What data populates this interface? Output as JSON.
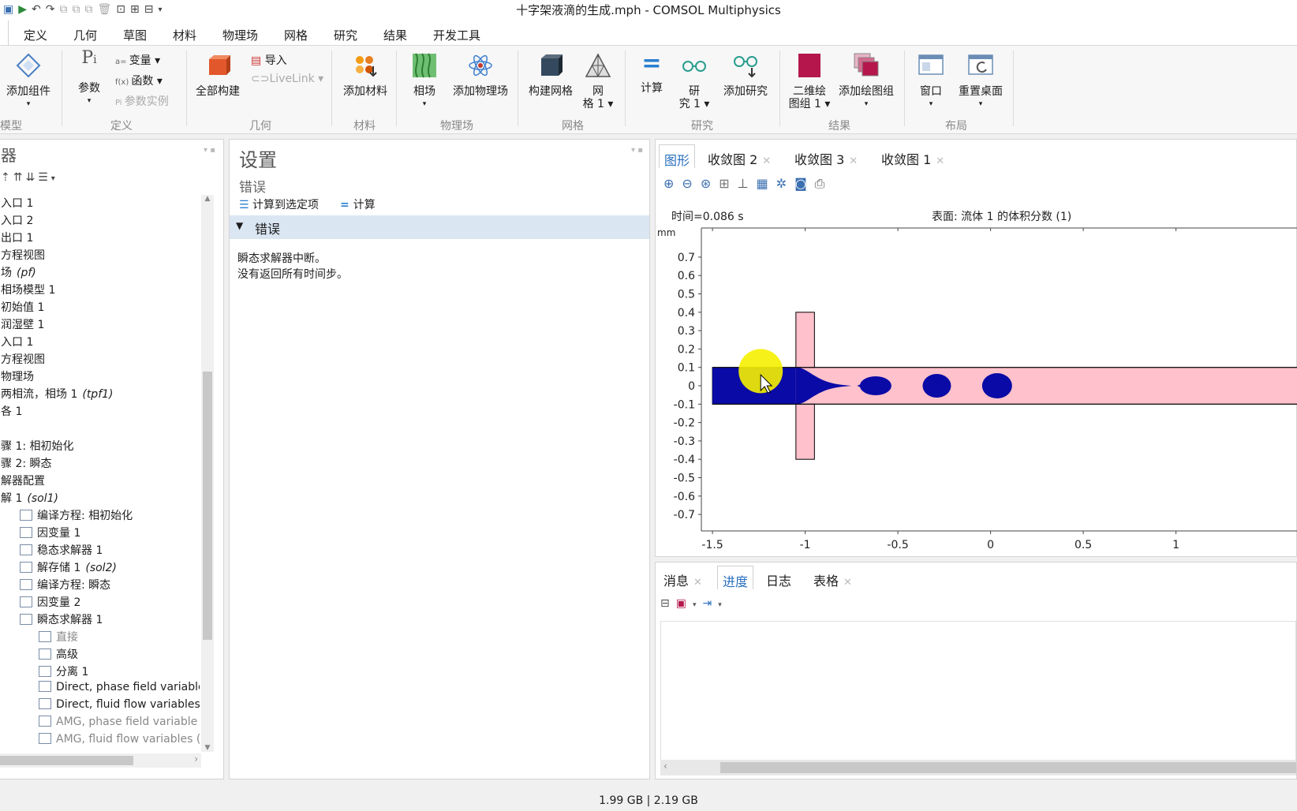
{
  "window": {
    "title": "十字架液滴的生成.mph - COMSOL Multiphysics"
  },
  "menu": {
    "tabs": [
      "定义",
      "几何",
      "草图",
      "材料",
      "物理场",
      "网格",
      "研究",
      "结果",
      "开发工具"
    ]
  },
  "ribbon": {
    "add_component": "添加组件",
    "params": "参数",
    "variables": "变量",
    "functions": "函数",
    "param_instance": "参数实例",
    "build_all": "全部构建",
    "import": "导入",
    "livelink": "LiveLink",
    "add_material": "添加材料",
    "phase_field": "相场",
    "add_physics": "添加物理场",
    "build_mesh": "构建网格",
    "mesh_line1": "网",
    "mesh_line2": "格 1",
    "compute": "计算",
    "study_line1": "研",
    "study_line2": "究 1",
    "add_study": "添加研究",
    "plot2d_line1": "二维绘",
    "plot2d_line2": "图组 1",
    "add_plot_group": "添加绘图组",
    "window": "窗口",
    "reset_desktop": "重置桌面",
    "groups": {
      "model": "模型",
      "definitions": "定义",
      "geometry": "几何",
      "materials": "材料",
      "physics": "物理场",
      "mesh": "网格",
      "study": "研究",
      "results": "结果",
      "layout": "布局"
    }
  },
  "tree": {
    "header": "器",
    "rows": [
      {
        "text": "入口 1",
        "x": 0
      },
      {
        "text": "入口 2",
        "x": 0
      },
      {
        "text": "出口 1",
        "x": 0
      },
      {
        "text": "方程视图",
        "x": 0
      },
      {
        "text": "场",
        "italic": "(pf)",
        "x": 0
      },
      {
        "text": "相场模型 1",
        "x": 0
      },
      {
        "text": "初始值 1",
        "x": 0
      },
      {
        "text": "润湿壁 1",
        "x": 0
      },
      {
        "text": "入口 1",
        "x": 0
      },
      {
        "text": "方程视图",
        "x": 0
      },
      {
        "text": "物理场",
        "x": 0
      },
      {
        "text": "两相流，相场 1",
        "italic": "(tpf1)",
        "x": 0
      },
      {
        "text": "各 1",
        "x": 0
      },
      {
        "text": "",
        "x": 0
      },
      {
        "text": "骤 1: 相初始化",
        "x": 0
      },
      {
        "text": "骤 2: 瞬态",
        "x": 0
      },
      {
        "text": "解器配置",
        "x": 0
      },
      {
        "text": "解 1",
        "italic": "(sol1)",
        "x": 0
      },
      {
        "text": "编译方程: 相初始化",
        "x": 24,
        "icon": true
      },
      {
        "text": "因变量 1",
        "x": 24,
        "icon": true
      },
      {
        "text": "稳态求解器 1",
        "x": 24,
        "icon": true
      },
      {
        "text": "解存储 1",
        "italic": "(sol2)",
        "x": 24,
        "icon": true
      },
      {
        "text": "编译方程: 瞬态",
        "x": 24,
        "icon": true
      },
      {
        "text": "因变量 2",
        "x": 24,
        "icon": true
      },
      {
        "text": "瞬态求解器 1",
        "x": 24,
        "icon": true
      },
      {
        "text": "直接",
        "x": 48,
        "icon": true,
        "dim": true
      },
      {
        "text": "高级",
        "x": 48,
        "icon": true
      },
      {
        "text": "分离 1",
        "x": 48,
        "icon": true
      },
      {
        "text": "Direct, phase field variable (t",
        "x": 48,
        "icon": true
      },
      {
        "text": "Direct, fluid flow variables (tp",
        "x": 48,
        "icon": true
      },
      {
        "text": "AMG, phase field variable (tp",
        "x": 48,
        "icon": true,
        "dim": true
      },
      {
        "text": "AMG, fluid flow variables (tp",
        "x": 48,
        "icon": true,
        "dim": true
      }
    ]
  },
  "settings": {
    "title": "设置",
    "subtitle": "错误",
    "compute_selected": "计算到选定项",
    "compute": "计算",
    "section": "错误",
    "message_line1": "瞬态求解器中断。",
    "message_line2": "没有返回所有时间步。"
  },
  "graphics_tabs": [
    {
      "label": "图形",
      "active": true
    },
    {
      "label": "收敛图 2"
    },
    {
      "label": "收敛图 3"
    },
    {
      "label": "收敛图 1"
    }
  ],
  "plot": {
    "time_label": "时间=0.086 s",
    "surface_label": "表面: 流体 1 的体积分数 (1)",
    "unit": "mm",
    "yticks": [
      "0.7",
      "0.6",
      "0.5",
      "0.4",
      "0.3",
      "0.2",
      "0.1",
      "0",
      "-0.1",
      "-0.2",
      "-0.3",
      "-0.4",
      "-0.5",
      "-0.6",
      "-0.7"
    ],
    "xticks": [
      "-1.5",
      "-1",
      "-0.5",
      "0",
      "0.5",
      "1"
    ],
    "colors": {
      "fluid1": "#0a0aa6",
      "fluid2": "#ffc1cc"
    }
  },
  "bottom_tabs": [
    {
      "label": "消息"
    },
    {
      "label": "进度",
      "active": true
    },
    {
      "label": "日志"
    },
    {
      "label": "表格"
    }
  ],
  "status": {
    "memory": "1.99 GB | 2.19 GB"
  }
}
